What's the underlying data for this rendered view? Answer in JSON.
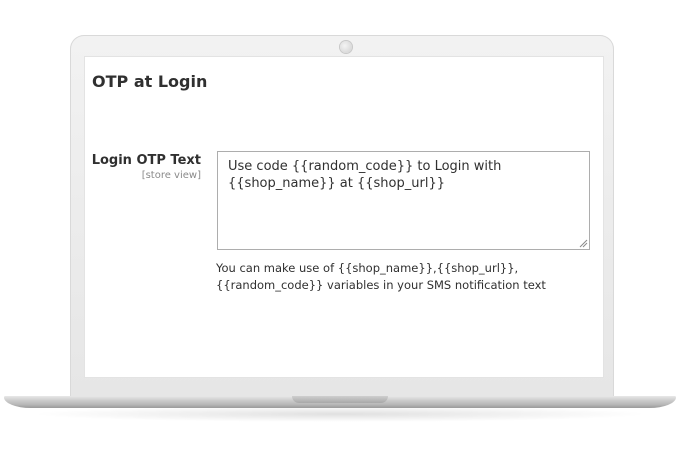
{
  "section": {
    "title": "OTP at Login"
  },
  "field": {
    "label": "Login OTP Text",
    "scope": "[store view]",
    "value": "Use code {{random_code}} to Login with {{shop_name}} at {{shop_url}}",
    "note": "You can make use of {{shop_name}},{{shop_url}},{{random_code}} variables in your SMS notification text"
  },
  "icons": {
    "camera": "camera-icon",
    "resize": "resize-grip-icon"
  },
  "colors": {
    "text": "#303030",
    "scope_text": "#8a8a8a",
    "border": "#adadad",
    "device_frame": "#e6e6e6"
  }
}
